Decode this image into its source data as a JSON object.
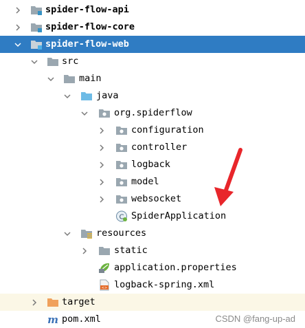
{
  "tree": {
    "modules": [
      "spider-flow-api",
      "spider-flow-core",
      "spider-flow-web"
    ],
    "src": "src",
    "main": "main",
    "java": "java",
    "package": "org.spiderflow",
    "packages": [
      "configuration",
      "controller",
      "logback",
      "model",
      "websocket"
    ],
    "main_class": "SpiderApplication",
    "resources": "resources",
    "static": "static",
    "application_properties": "application.properties",
    "logback_xml": "logback-spring.xml",
    "target": "target",
    "pom": "pom.xml"
  },
  "colors": {
    "selection": "#2f7cc3",
    "excluded_bg": "#fbf7e6",
    "folder": "#9aa7b0",
    "source_folder": "#6ebbe6",
    "excluded_folder": "#f0a15c",
    "annotation_arrow": "#e8262b"
  },
  "icons": {
    "module": "module-folder-icon",
    "folder": "folder-icon",
    "source_root": "source-folder-icon",
    "package": "package-icon",
    "resources_root": "resources-folder-icon",
    "excluded": "excluded-folder-icon",
    "class": "spring-class-icon",
    "properties": "spring-properties-icon",
    "xml": "xml-file-icon",
    "maven": "maven-icon"
  },
  "watermark": "CSDN @fang-up-ad"
}
